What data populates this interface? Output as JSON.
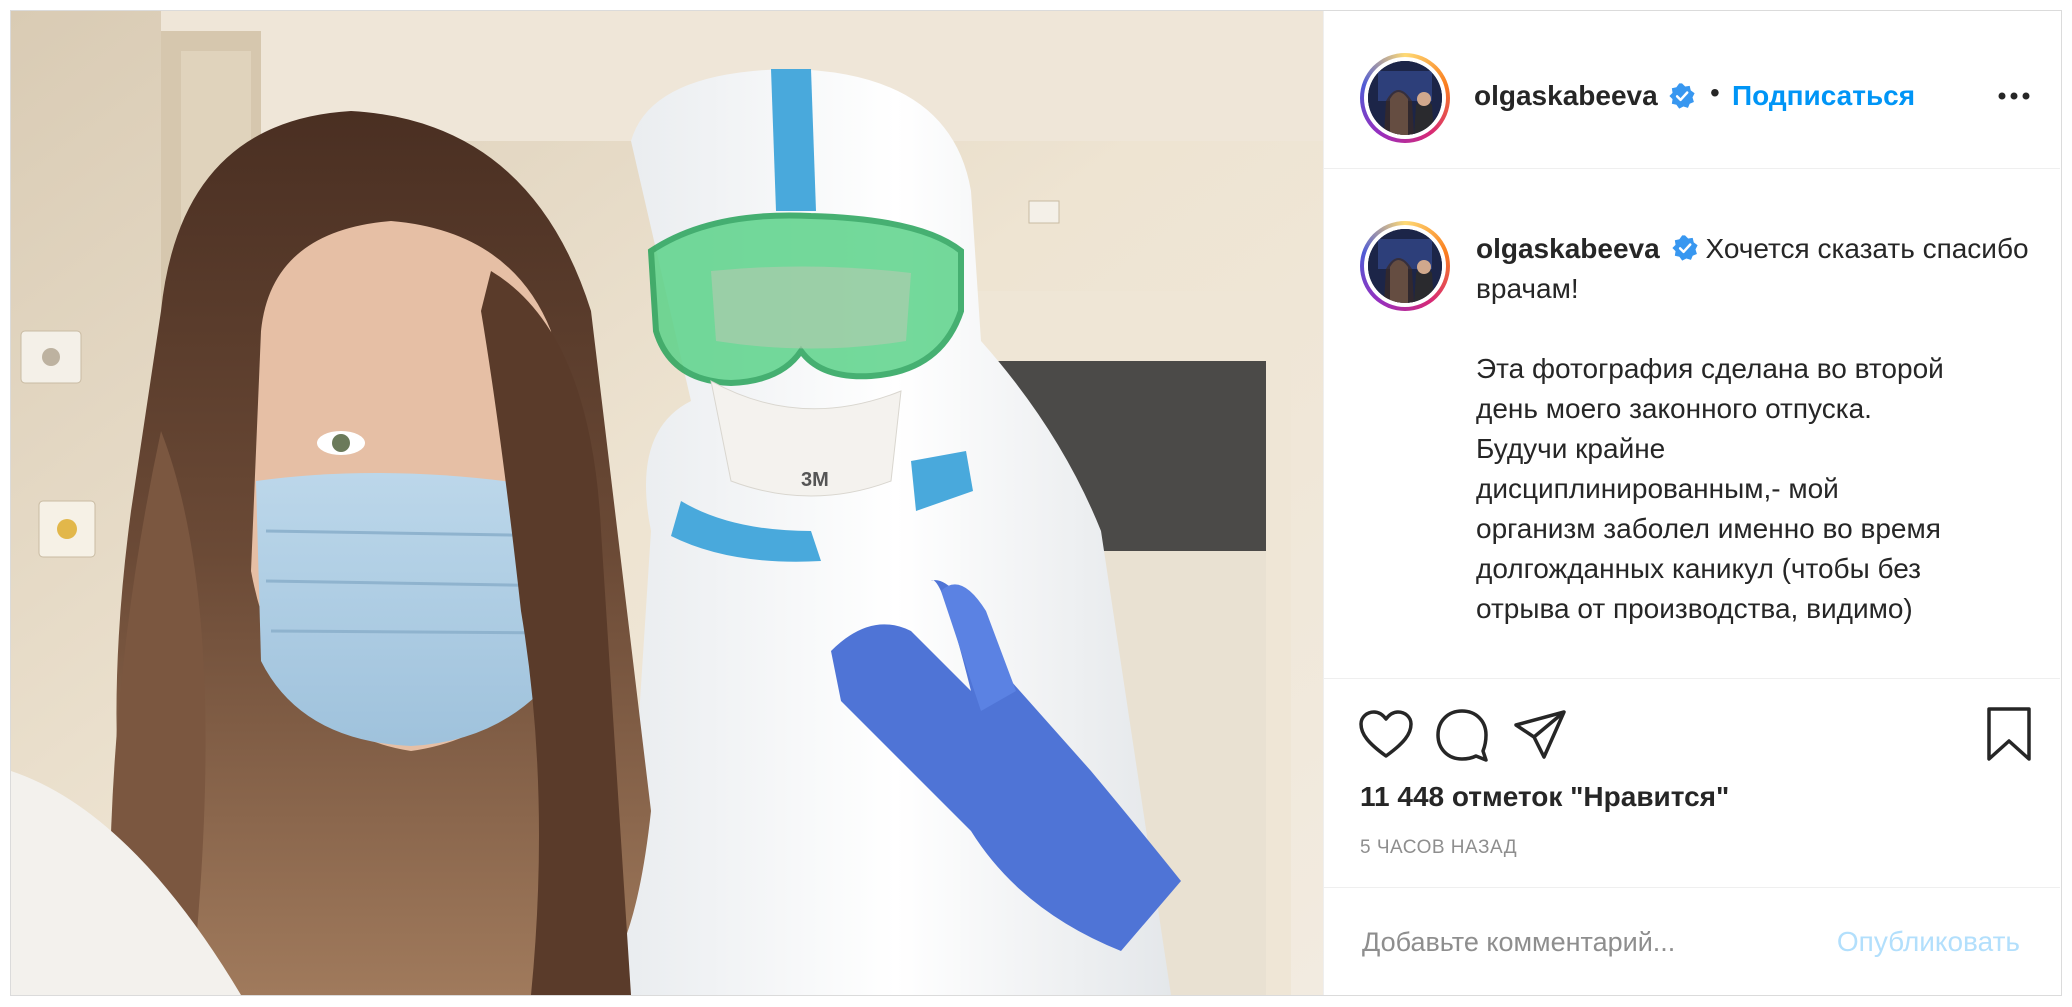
{
  "post": {
    "username": "olgaskabeeva",
    "follow_label": "Подписаться",
    "separator": "•",
    "caption": {
      "username": "olgaskabeeva",
      "line1": "Хочется сказать спасибо врачам!",
      "body_lines": [
        "Эта фотография сделана во второй",
        "день моего законного отпуска.",
        "Будучи крайне",
        "дисциплинированным,- мой",
        "организм заболел именно во время",
        "долгожданных каникул (чтобы без",
        "отрыва от производства, видимо)"
      ]
    },
    "likes": "11 448 отметок \"Нравится\"",
    "time_ago": "5 ЧАСОВ НАЗАД",
    "comment": {
      "placeholder": "Добавьте комментарий...",
      "value": "",
      "publish_label": "Опубликовать"
    }
  },
  "icons": {
    "verified": "verified-badge-icon",
    "more": "more-options-icon",
    "like": "heart-icon",
    "comment": "comment-bubble-icon",
    "share": "paper-plane-icon",
    "save": "bookmark-icon"
  },
  "colors": {
    "accent": "#0095f6",
    "publish_disabled": "#b2dffc",
    "text": "#262626",
    "muted": "#8e8e8e",
    "border": "#dbdbdb"
  }
}
